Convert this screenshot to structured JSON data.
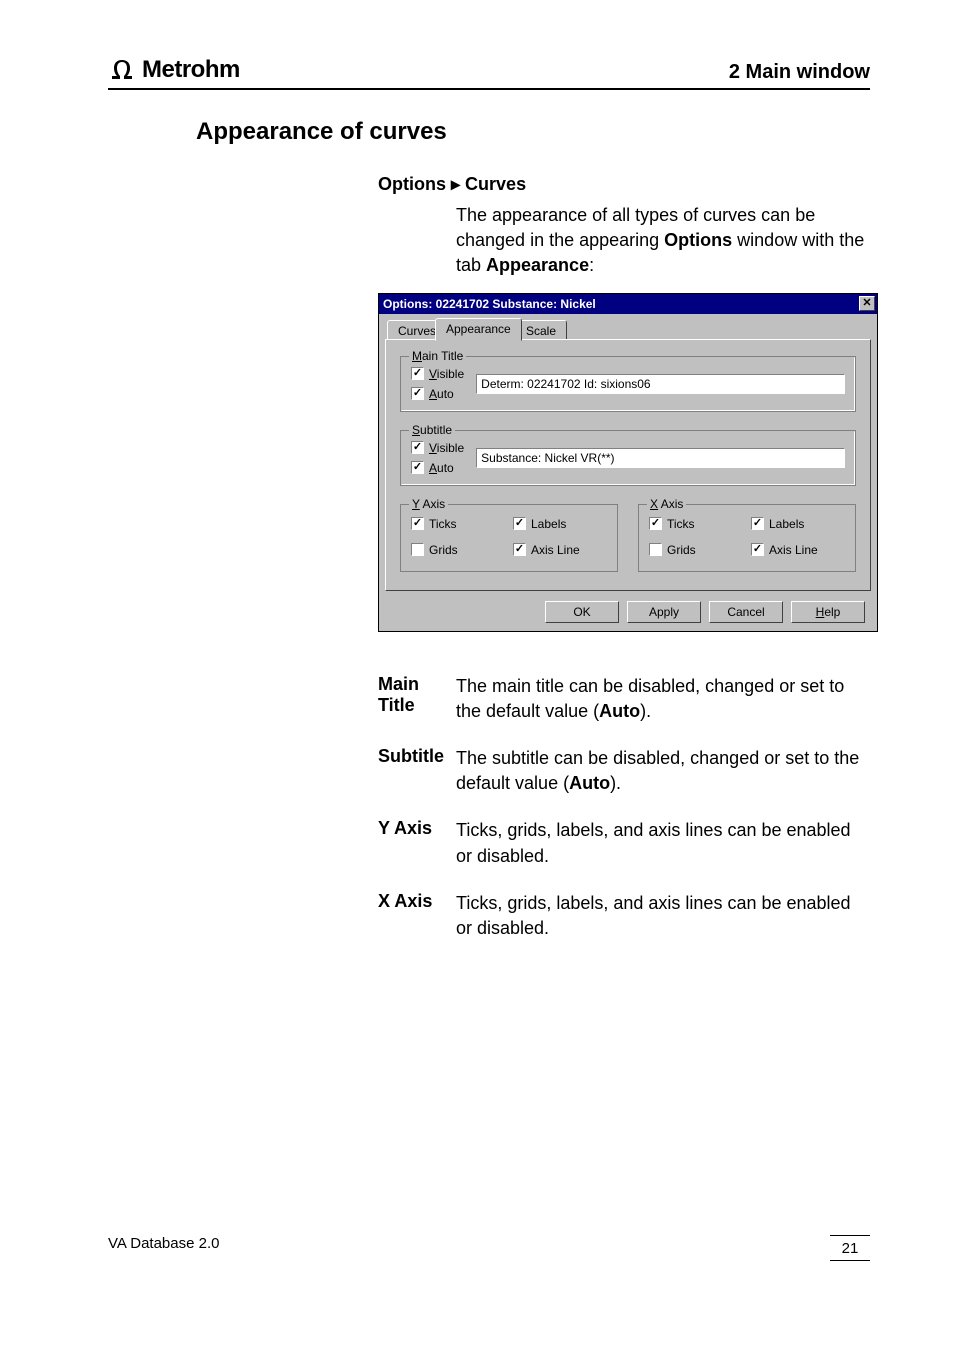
{
  "header": {
    "brand": "Metrohm",
    "section": "2  Main window"
  },
  "title": "Appearance of curves",
  "menu_path": {
    "m1": "Options",
    "m2": "Curves"
  },
  "intro": {
    "line1_a": "The appearance of all types of curves can be changed in the appearing ",
    "line1_b": "Options",
    "line1_c": " window with the tab ",
    "line1_d": "Appearance",
    "line1_e": ":"
  },
  "dialog": {
    "title": "Options: 02241702 Substance: Nickel",
    "tabs": {
      "t1": "Curves",
      "t2": "Appearance",
      "t3": "Scale"
    },
    "mainTitle": {
      "legend_pre": "M",
      "legend_post": "ain Title",
      "visible_pre": "V",
      "visible_post": "isible",
      "visible_checked": "✓",
      "auto_pre": "A",
      "auto_post": "uto",
      "auto_checked": "✓",
      "value": "Determ: 02241702 Id: sixions06"
    },
    "subtitle": {
      "legend_pre": "S",
      "legend_post": "ubtitle",
      "visible_pre": "V",
      "visible_post": "isible",
      "visible_checked": "✓",
      "auto_pre": "A",
      "auto_post": "uto",
      "auto_checked": "✓",
      "value": "Substance: Nickel VR(**)"
    },
    "yaxis": {
      "legend_pre": "Y",
      "legend_post": " Axis",
      "ticks": "Ticks",
      "ticks_checked": "✓",
      "labels": "Labels",
      "labels_checked": "✓",
      "grids": "Grids",
      "grids_checked": "",
      "axisline": "Axis Line",
      "axisline_checked": "✓"
    },
    "xaxis": {
      "legend_pre": "X",
      "legend_post": " Axis",
      "ticks": "Ticks",
      "ticks_checked": "✓",
      "labels": "Labels",
      "labels_checked": "✓",
      "grids": "Grids",
      "grids_checked": "",
      "axisline": "Axis Line",
      "axisline_checked": "✓"
    },
    "buttons": {
      "ok": "OK",
      "apply": "Apply",
      "cancel": "Cancel",
      "help_pre": "H",
      "help_post": "elp"
    }
  },
  "defs": {
    "d1_term": "Main Title",
    "d1_a": "The main title can be disabled, changed or set to the default value (",
    "d1_b": "Auto",
    "d1_c": ").",
    "d2_term": "Subtitle",
    "d2_a": "The subtitle can be disabled, changed or set to the default value (",
    "d2_b": "Auto",
    "d2_c": ").",
    "d3_term": "Y Axis",
    "d3_body": "Ticks, grids, labels, and axis lines can be enabled or disabled.",
    "d4_term": "X Axis",
    "d4_body": "Ticks, grids, labels, and axis lines can be enabled or disabled."
  },
  "footer": {
    "left": "VA Database 2.0",
    "right": "21"
  }
}
